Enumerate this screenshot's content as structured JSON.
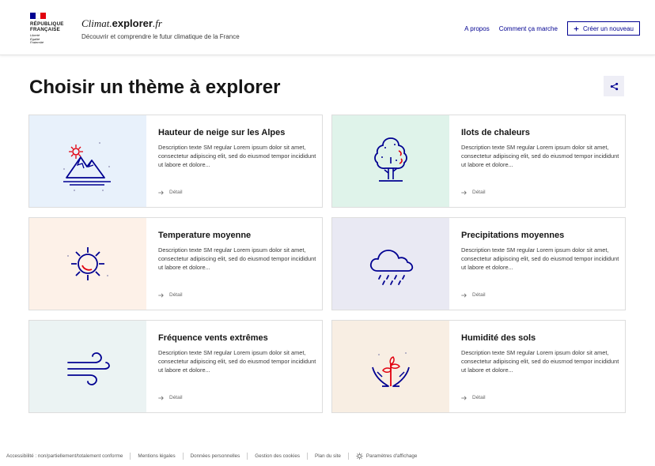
{
  "brand": {
    "flag_colors": [
      "#000091",
      "#ffffff",
      "#e1000f"
    ],
    "lines": [
      "RÉPUBLIQUE",
      "FRANÇAISE"
    ],
    "motto": [
      "Liberté",
      "Égalité",
      "Fraternité"
    ]
  },
  "service": {
    "title_pre": "Climat.",
    "title_bold": "explorer",
    "title_post": ".fr",
    "tagline": "Découvrir et comprendre le futur climatique de la France"
  },
  "nav": {
    "about": "A propos",
    "how": "Comment ça marche",
    "create": "Créer un nouveau"
  },
  "page": {
    "title": "Choisir un thème à explorer"
  },
  "colors": {
    "primary": "#000091",
    "accent_red": "#e1000f"
  },
  "cards": [
    {
      "title": "Hauteur de neige sur les Alpes",
      "desc": "Description texte SM regular Lorem ipsum dolor sit amet, consectetur adipiscing elit, sed do eiusmod tempor incididunt ut labore et dolore...",
      "detail": "Détail",
      "icon": "mountain-sun-icon",
      "bg": "#e8f1fb"
    },
    {
      "title": "Ilots de chaleurs",
      "desc": "Description texte SM regular Lorem ipsum dolor sit amet, consectetur adipiscing elit, sed do eiusmod tempor incididunt ut labore et dolore...",
      "detail": "Détail",
      "icon": "tree-icon",
      "bg": "#dff3ea"
    },
    {
      "title": "Temperature moyenne",
      "desc": "Description texte SM regular Lorem ipsum dolor sit amet, consectetur adipiscing elit, sed do eiusmod tempor incididunt ut labore et dolore...",
      "detail": "Détail",
      "icon": "sun-icon",
      "bg": "#fdf1e8"
    },
    {
      "title": "Precipitations moyennes",
      "desc": "Description texte SM regular Lorem ipsum dolor sit amet, consectetur adipiscing elit, sed do eiusmod tempor incididunt ut labore et dolore...",
      "detail": "Détail",
      "icon": "rain-cloud-icon",
      "bg": "#e9e9f3"
    },
    {
      "title": "Fréquence vents extrêmes",
      "desc": "Description texte SM regular Lorem ipsum dolor sit amet, consectetur adipiscing elit, sed do eiusmod tempor incididunt ut labore et dolore...",
      "detail": "Détail",
      "icon": "wind-icon",
      "bg": "#ebf3f3"
    },
    {
      "title": "Humidité des sols",
      "desc": "Description texte SM regular Lorem ipsum dolor sit amet, consectetur adipiscing elit, sed do eiusmod tempor incididunt ut labore et dolore...",
      "detail": "Détail",
      "icon": "plant-hands-icon",
      "bg": "#f8eee3"
    }
  ],
  "footer": {
    "links": [
      "Accessibilité : non/partiellement/totalement conforme",
      "Mentions légales",
      "Données personnelles",
      "Gestion des cookies",
      "Plan du site"
    ],
    "display_settings": "Paramètres d'affichage"
  }
}
